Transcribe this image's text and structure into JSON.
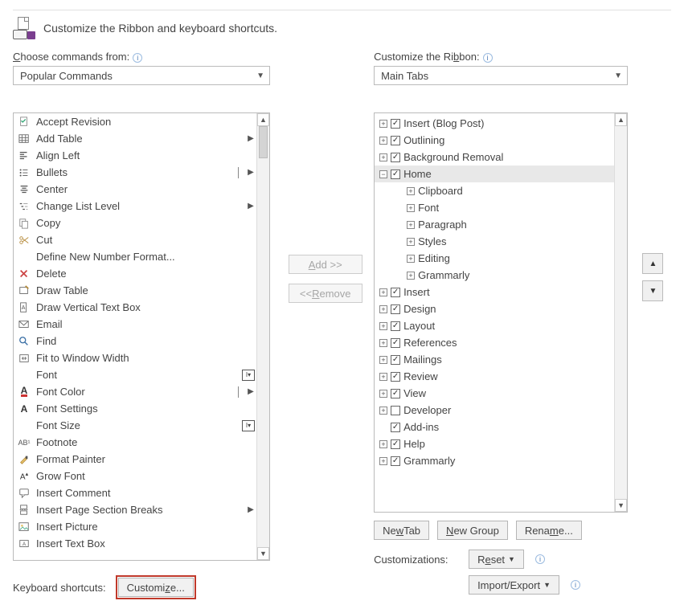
{
  "header": {
    "title": "Customize the Ribbon and keyboard shortcuts."
  },
  "left": {
    "label": "Choose commands from:",
    "combo": "Popular Commands",
    "commands": [
      {
        "label": "Accept Revision",
        "icon": "check-doc"
      },
      {
        "label": "Add Table",
        "icon": "table",
        "submenu": true
      },
      {
        "label": "Align Left",
        "icon": "align-left"
      },
      {
        "label": "Bullets",
        "icon": "bullets",
        "submenu": true,
        "bar": true
      },
      {
        "label": "Center",
        "icon": "center"
      },
      {
        "label": "Change List Level",
        "icon": "list-level",
        "submenu": true
      },
      {
        "label": "Copy",
        "icon": "copy"
      },
      {
        "label": "Cut",
        "icon": "scissors"
      },
      {
        "label": "Define New Number Format...",
        "icon": "blank"
      },
      {
        "label": "Delete",
        "icon": "delete-x"
      },
      {
        "label": "Draw Table",
        "icon": "draw-table"
      },
      {
        "label": "Draw Vertical Text Box",
        "icon": "vtextbox"
      },
      {
        "label": "Email",
        "icon": "email"
      },
      {
        "label": "Find",
        "icon": "find"
      },
      {
        "label": "Fit to Window Width",
        "icon": "fit"
      },
      {
        "label": "Font",
        "icon": "blank",
        "glyph": "I▾"
      },
      {
        "label": "Font Color",
        "icon": "font-color",
        "submenu": true,
        "bar": true
      },
      {
        "label": "Font Settings",
        "icon": "font-a"
      },
      {
        "label": "Font Size",
        "icon": "blank",
        "glyph": "I▾"
      },
      {
        "label": "Footnote",
        "icon": "footnote"
      },
      {
        "label": "Format Painter",
        "icon": "brush"
      },
      {
        "label": "Grow Font",
        "icon": "grow-font"
      },
      {
        "label": "Insert Comment",
        "icon": "comment"
      },
      {
        "label": "Insert Page  Section Breaks",
        "icon": "page-break",
        "submenu": true
      },
      {
        "label": "Insert Picture",
        "icon": "picture"
      },
      {
        "label": "Insert Text Box",
        "icon": "textbox"
      }
    ]
  },
  "mid": {
    "add": "Add >>",
    "remove": "<< Remove"
  },
  "right": {
    "label": "Customize the Ribbon:",
    "combo": "Main Tabs",
    "tree": [
      {
        "indent": 0,
        "pm": "+",
        "chk": true,
        "label": "Insert (Blog Post)"
      },
      {
        "indent": 0,
        "pm": "+",
        "chk": true,
        "label": "Outlining"
      },
      {
        "indent": 0,
        "pm": "+",
        "chk": true,
        "label": "Background Removal"
      },
      {
        "indent": 0,
        "pm": "-",
        "chk": true,
        "label": "Home",
        "sel": true
      },
      {
        "indent": 1,
        "pm": "+",
        "label": "Clipboard"
      },
      {
        "indent": 1,
        "pm": "+",
        "label": "Font"
      },
      {
        "indent": 1,
        "pm": "+",
        "label": "Paragraph"
      },
      {
        "indent": 1,
        "pm": "+",
        "label": "Styles"
      },
      {
        "indent": 1,
        "pm": "+",
        "label": "Editing"
      },
      {
        "indent": 1,
        "pm": "+",
        "label": "Grammarly"
      },
      {
        "indent": 0,
        "pm": "+",
        "chk": true,
        "label": "Insert"
      },
      {
        "indent": 0,
        "pm": "+",
        "chk": true,
        "label": "Design"
      },
      {
        "indent": 0,
        "pm": "+",
        "chk": true,
        "label": "Layout"
      },
      {
        "indent": 0,
        "pm": "+",
        "chk": true,
        "label": "References"
      },
      {
        "indent": 0,
        "pm": "+",
        "chk": true,
        "label": "Mailings"
      },
      {
        "indent": 0,
        "pm": "+",
        "chk": true,
        "label": "Review"
      },
      {
        "indent": 0,
        "pm": "+",
        "chk": true,
        "label": "View"
      },
      {
        "indent": 0,
        "pm": "+",
        "chk": false,
        "label": "Developer"
      },
      {
        "indent": 0,
        "pm": " ",
        "chk": true,
        "label": "Add-ins"
      },
      {
        "indent": 0,
        "pm": "+",
        "chk": true,
        "label": "Help"
      },
      {
        "indent": 0,
        "pm": "+",
        "chk": true,
        "label": "Grammarly"
      }
    ],
    "buttons": {
      "newtab": "New Tab",
      "newgroup": "New Group",
      "rename": "Rename..."
    },
    "customizations_label": "Customizations:",
    "reset": "Reset",
    "importexport": "Import/Export"
  },
  "kbd": {
    "label": "Keyboard shortcuts:",
    "button": "Customize..."
  }
}
